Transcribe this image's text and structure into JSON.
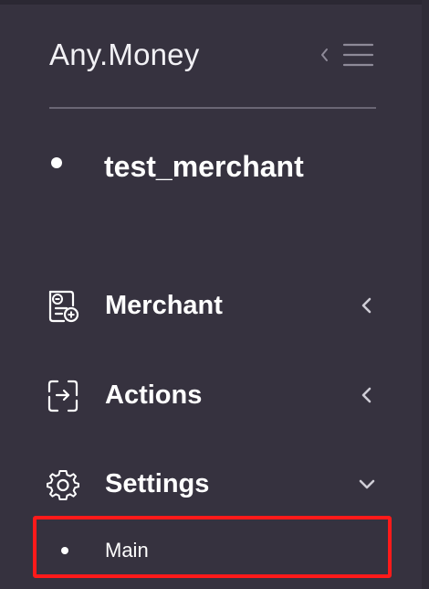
{
  "brand": {
    "title": "Any.Money"
  },
  "account": {
    "name": "test_merchant"
  },
  "nav": {
    "items": [
      {
        "label": "Merchant",
        "icon": "merchant-icon",
        "state": "collapsed"
      },
      {
        "label": "Actions",
        "icon": "actions-icon",
        "state": "collapsed"
      },
      {
        "label": "Settings",
        "icon": "gear-icon",
        "state": "expanded"
      }
    ],
    "settings_children": [
      {
        "label": "Main",
        "highlighted": true
      }
    ]
  },
  "colors": {
    "sidebar_background": "#36323f",
    "text": "#ffffff",
    "highlight_border": "#ff1a1a",
    "divider": "#6a6674"
  }
}
